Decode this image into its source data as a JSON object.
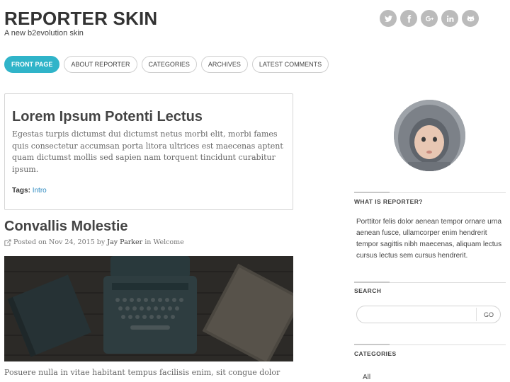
{
  "site": {
    "title": "REPORTER SKIN",
    "tagline": "A new b2evolution skin"
  },
  "social_links": [
    {
      "icon": "twitter-icon"
    },
    {
      "icon": "facebook-icon"
    },
    {
      "icon": "google-plus-icon"
    },
    {
      "icon": "linkedin-icon"
    },
    {
      "icon": "github-icon"
    }
  ],
  "nav": {
    "items": [
      {
        "label": "FRONT PAGE",
        "active": true
      },
      {
        "label": "ABOUT REPORTER",
        "active": false
      },
      {
        "label": "CATEGORIES",
        "active": false
      },
      {
        "label": "ARCHIVES",
        "active": false
      },
      {
        "label": "LATEST COMMENTS",
        "active": false
      }
    ]
  },
  "featured": {
    "title": "Lorem Ipsum Potenti Lectus",
    "body": "Egestas turpis dictumst dui dictumst netus morbi elit, morbi fames quis consectetur accumsan porta litora ultrices est maecenas aptent quam dictumst mollis sed sapien nam torquent tincidunt curabitur ipsum.",
    "tags_label": "Tags:",
    "tag": "Intro"
  },
  "post": {
    "title": "Convallis Molestie",
    "posted_prefix": "Posted on",
    "date": "Nov 24, 2015",
    "by": "by",
    "author": "Jay Parker",
    "in": "in",
    "category": "Welcome",
    "excerpt": "Posuere nulla in vitae habitant tempus facilisis enim, sit congue dolor"
  },
  "sidebar": {
    "about_title": "WHAT IS REPORTER?",
    "about_text": "Porttitor felis dolor aenean tempor ornare urna aenean fusce, ullamcorper enim hendrerit tempor sagittis nibh maecenas, aliquam lectus cursus lectus sem cursus hendrerit.",
    "search_title": "SEARCH",
    "search_value": "",
    "search_button": "GO",
    "categories_title": "CATEGORIES",
    "categories": [
      "All"
    ]
  },
  "colors": {
    "accent": "#30b4c9",
    "link": "#2f8bc1",
    "social_bg": "#bbbbbb"
  }
}
